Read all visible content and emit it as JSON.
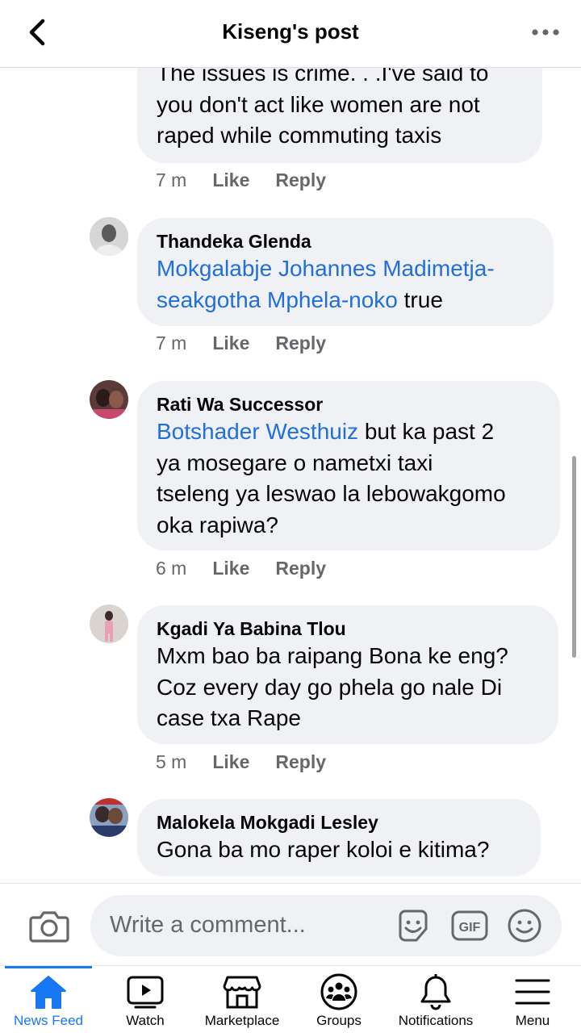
{
  "header": {
    "title": "Kiseng's post"
  },
  "comments": [
    {
      "name": "",
      "mention": "",
      "text_lines": [
        "The issues is crime. . .I've said to",
        "you don't act like women are not",
        "raped while commuting taxis"
      ],
      "time": "7 m",
      "like": "Like",
      "reply": "Reply"
    },
    {
      "name": "Thandeka Glenda",
      "line1_mention": "Mokgalabje Johannes Madimetja-",
      "line2_mention": "seakgotha Mphela-noko",
      "line2_text": " true",
      "time": "7 m",
      "like": "Like",
      "reply": "Reply"
    },
    {
      "name": "Rati Wa Successor",
      "line1_mention": "Botshader Westhuiz",
      "line1_text": " but ka past 2",
      "text_lines": [
        "ya mosegare o nametxi taxi",
        "tseleng ya leswao la lebowakgomo",
        "oka rapiwa?"
      ],
      "time": "6 m",
      "like": "Like",
      "reply": "Reply"
    },
    {
      "name": "Kgadi Ya Babina Tlou",
      "text_lines": [
        "Mxm bao ba raipang Bona ke eng?",
        "Coz every day go phela go nale Di",
        "case txa Rape"
      ],
      "time": "5 m",
      "like": "Like",
      "reply": "Reply"
    },
    {
      "name": "Malokela Mokgadi Lesley",
      "text_lines": [
        "Gona ba mo raper koloi e kitima?"
      ]
    }
  ],
  "compose": {
    "placeholder": "Write a comment..."
  },
  "tabs": [
    {
      "label": "News Feed",
      "icon": "home-icon",
      "active": true
    },
    {
      "label": "Watch",
      "icon": "watch-icon"
    },
    {
      "label": "Marketplace",
      "icon": "marketplace-icon"
    },
    {
      "label": "Groups",
      "icon": "groups-icon"
    },
    {
      "label": "Notifications",
      "icon": "bell-icon"
    },
    {
      "label": "Menu",
      "icon": "hamburger-icon"
    }
  ],
  "colors": {
    "accent": "#1877f2",
    "mention": "#216fdb",
    "bubble": "#eff1f4",
    "meta": "#65676b"
  }
}
